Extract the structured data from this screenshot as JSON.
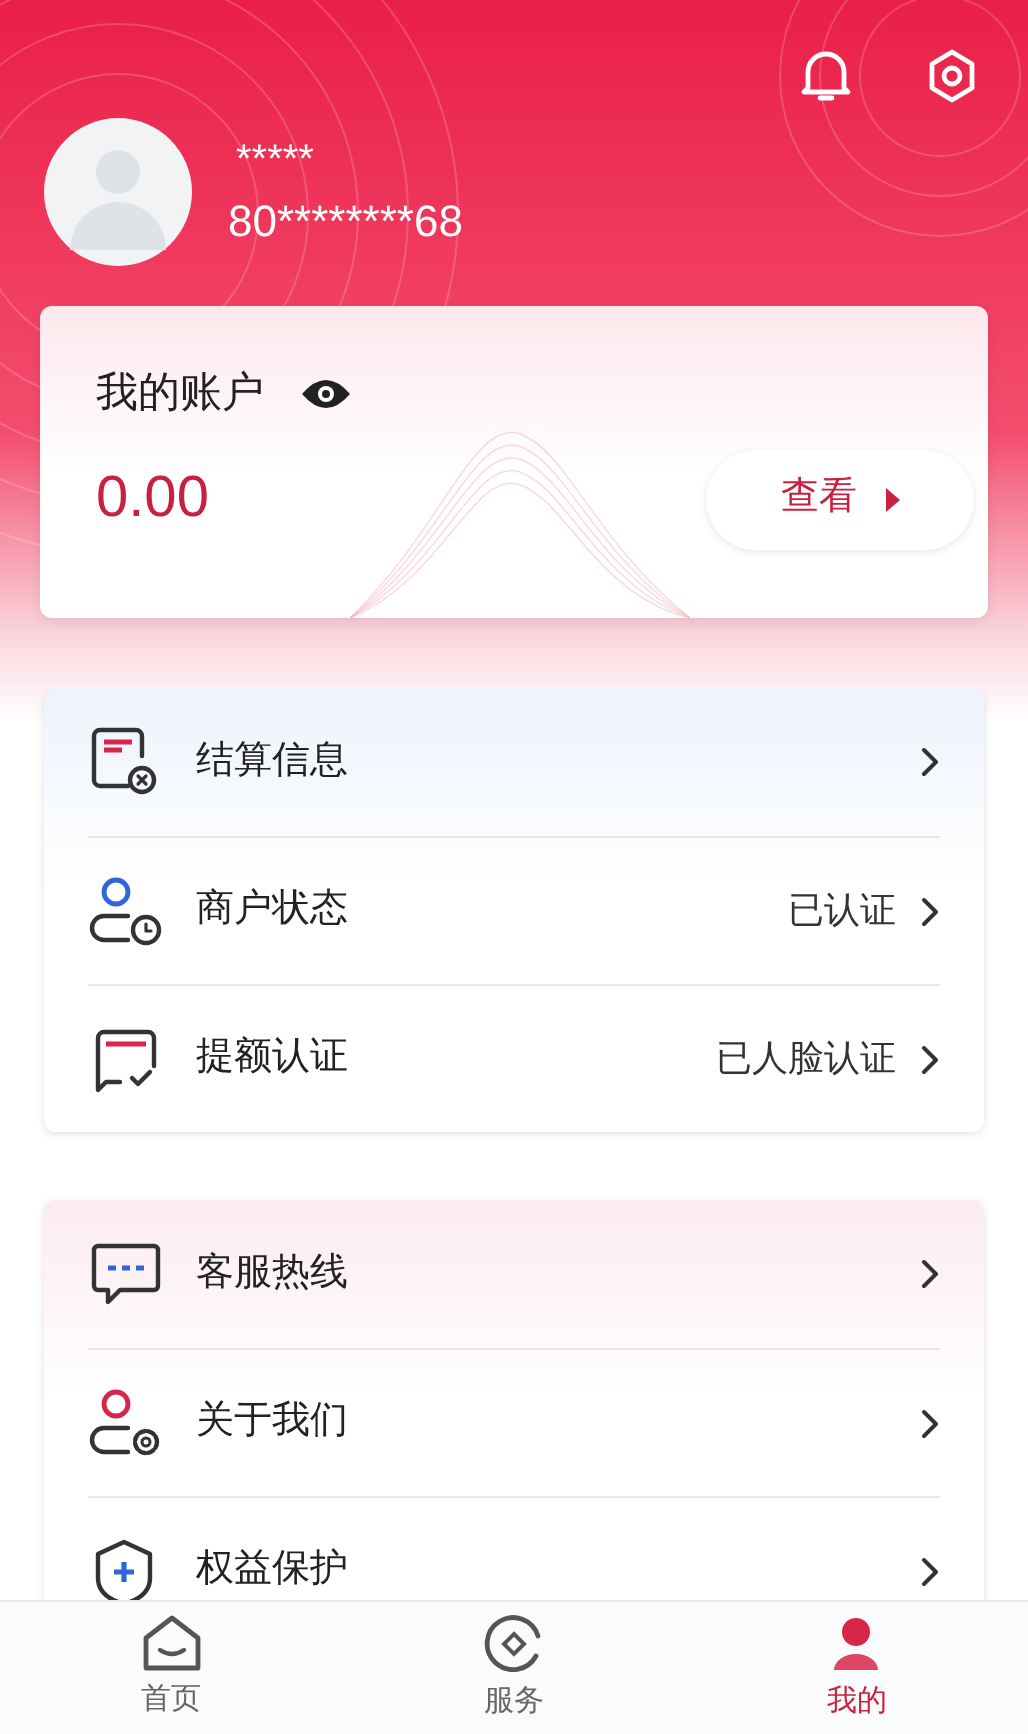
{
  "header": {
    "name": "*****",
    "account_number": "80********68"
  },
  "account_card": {
    "title": "我的账户",
    "balance": "0.00",
    "view_button": "查看"
  },
  "groups": [
    {
      "kind": "blue",
      "items": [
        {
          "kind": "settlement",
          "label": "结算信息"
        },
        {
          "kind": "merchant",
          "label": "商户状态",
          "status": "已认证"
        },
        {
          "kind": "limit",
          "label": "提额认证",
          "status": "已人脸认证"
        }
      ]
    },
    {
      "kind": "pink",
      "items": [
        {
          "kind": "hotline",
          "label": "客服热线"
        },
        {
          "kind": "about",
          "label": "关于我们"
        },
        {
          "kind": "protect",
          "label": "权益保护"
        }
      ]
    }
  ],
  "tab_bar": [
    {
      "kind": "home",
      "label": "首页",
      "selected": false
    },
    {
      "kind": "service",
      "label": "服务",
      "selected": false
    },
    {
      "kind": "mine",
      "label": "我的",
      "selected": true
    }
  ]
}
